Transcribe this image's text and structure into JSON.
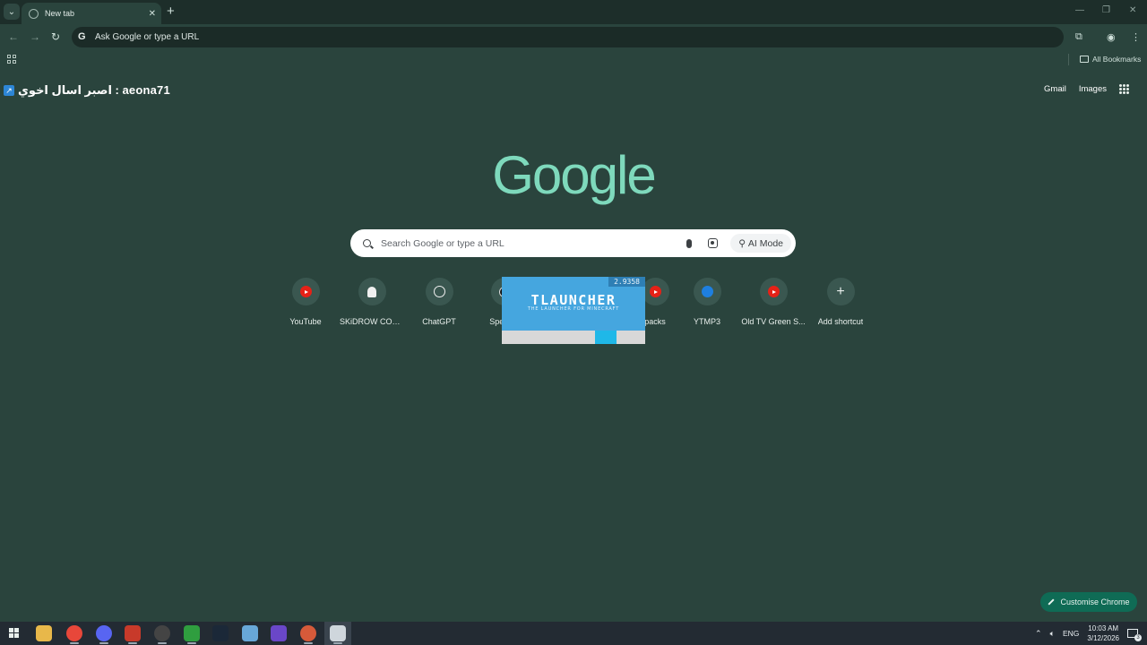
{
  "browser": {
    "tab_title": "New tab",
    "omnibox_placeholder": "Ask Google or type a URL",
    "all_bookmarks_label": "All Bookmarks"
  },
  "overlay": {
    "text": "اصبر اسال اخوي : aeona71"
  },
  "top_links": {
    "gmail": "Gmail",
    "images": "Images"
  },
  "google_logo": "Google",
  "search": {
    "placeholder": "Search Google or type a URL",
    "ai_mode_label": "AI Mode"
  },
  "shortcuts": [
    {
      "label": "YouTube",
      "icon": "youtube-icon"
    },
    {
      "label": "SKiDROW COD...",
      "icon": "ghost-icon"
    },
    {
      "label": "ChatGPT",
      "icon": "chatgpt-icon"
    },
    {
      "label": "Speedte",
      "icon": "speedtest-icon"
    },
    {
      "label": "packs",
      "icon": "youtube-icon"
    },
    {
      "label": "YTMP3",
      "icon": "ytmp3-icon"
    },
    {
      "label": "Old TV Green S...",
      "icon": "youtube-icon"
    },
    {
      "label": "Add shortcut",
      "icon": "plus-icon"
    }
  ],
  "tlauncher": {
    "version": "2.9358",
    "title": "TLAUNCHER",
    "subtitle": "THE LAUNCHER FOR MINECRAFT",
    "progress": 0.8
  },
  "customise_label": "Customise Chrome",
  "taskbar": {
    "language": "ENG",
    "time": "10:03 AM",
    "date": "3/12/2026",
    "notification_count": "3"
  },
  "colors": {
    "background": "#2a443d",
    "google_logo": "#7ed9bc",
    "customise_button": "#0f6b55",
    "tlauncher": "#45a6df"
  }
}
